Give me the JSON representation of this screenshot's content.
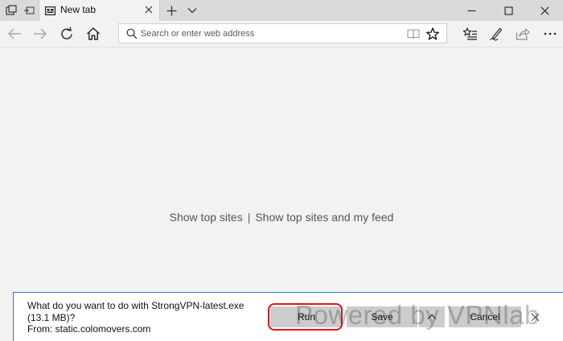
{
  "tab": {
    "title": "New tab"
  },
  "address": {
    "placeholder": "Search or enter web address",
    "value": ""
  },
  "content": {
    "show_top_sites": "Show top sites",
    "separator": "|",
    "show_top_sites_feed": "Show top sites and my feed"
  },
  "download": {
    "question": "What do you want to do with StrongVPN-latest.exe (13.1 MB)?",
    "from": "From: static.colomovers.com",
    "run_label": "Run",
    "save_label": "Save",
    "save_menu_icon": "chevron-up-icon",
    "cancel_label": "Cancel"
  },
  "watermark": "Powered by VPNlab",
  "colors": {
    "highlight": "#e2131e",
    "download_border": "#2a7fd8",
    "page_bg": "#f2f2f2",
    "tabstrip_bg": "#dadada"
  },
  "icons": {
    "tab_preview": "tab-preview-icon",
    "set_aside": "set-aside-tabs-icon",
    "tab_favicon": "new-tab-page-icon",
    "tab_close": "close-icon",
    "new_tab": "plus-icon",
    "tab_list": "chevron-down-icon",
    "minimize": "minimize-icon",
    "maximize": "maximize-icon",
    "close_window": "close-icon",
    "back": "back-arrow-icon",
    "forward": "forward-arrow-icon",
    "refresh": "refresh-icon",
    "home": "home-icon",
    "search": "search-icon",
    "reading_view": "reading-view-icon",
    "favorite": "star-icon",
    "hub": "hub-favorites-icon",
    "notes": "pen-icon",
    "share": "share-icon",
    "more": "more-icon"
  }
}
